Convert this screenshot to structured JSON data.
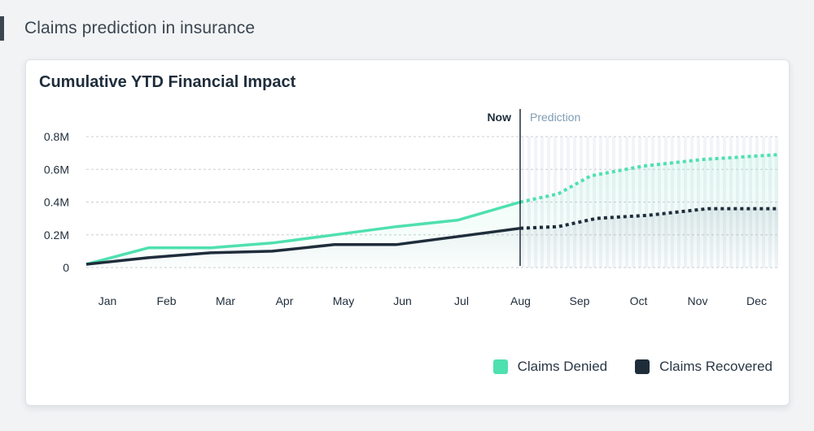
{
  "page": {
    "title": "Claims prediction in insurance"
  },
  "card": {
    "title": "Cumulative YTD Financial Impact"
  },
  "chart_data": {
    "type": "line",
    "title": "Cumulative YTD Financial Impact",
    "xlabel": "",
    "ylabel": "",
    "categories": [
      "Jan",
      "Feb",
      "Mar",
      "Apr",
      "May",
      "Jun",
      "Jul",
      "Aug",
      "Sep",
      "Oct",
      "Nov",
      "Dec"
    ],
    "y_ticks": [
      {
        "value": 0,
        "label": "0"
      },
      {
        "value": 0.2,
        "label": "0.2M"
      },
      {
        "value": 0.4,
        "label": "0.4M"
      },
      {
        "value": 0.6,
        "label": "0.6M"
      },
      {
        "value": 0.8,
        "label": "0.8M"
      }
    ],
    "ylim": [
      0,
      0.8
    ],
    "y_unit": "M",
    "grid": true,
    "now_marker": {
      "label": "Now",
      "at": "Aug"
    },
    "prediction_region": {
      "label": "Prediction",
      "from": "Aug",
      "to": "Dec"
    },
    "series": [
      {
        "name": "Claims Denied",
        "color": "#4fe0b0",
        "actual": [
          0.02,
          0.12,
          0.12,
          0.15,
          0.2,
          0.25,
          0.29,
          0.4
        ],
        "predicted_points": [
          {
            "x": 7.0,
            "y": 0.4
          },
          {
            "x": 7.65,
            "y": 0.45
          },
          {
            "x": 8.2,
            "y": 0.56
          },
          {
            "x": 9.1,
            "y": 0.62
          },
          {
            "x": 10.1,
            "y": 0.66
          },
          {
            "x": 11.4,
            "y": 0.69
          }
        ]
      },
      {
        "name": "Claims Recovered",
        "color": "#1f2d3b",
        "actual": [
          0.02,
          0.06,
          0.09,
          0.1,
          0.14,
          0.14,
          0.19,
          0.24
        ],
        "predicted_points": [
          {
            "x": 7.0,
            "y": 0.24
          },
          {
            "x": 7.65,
            "y": 0.25
          },
          {
            "x": 8.3,
            "y": 0.3
          },
          {
            "x": 9.2,
            "y": 0.32
          },
          {
            "x": 10.2,
            "y": 0.36
          },
          {
            "x": 11.4,
            "y": 0.36
          }
        ]
      }
    ],
    "legend": {
      "position": "bottom-right",
      "items": [
        {
          "label": "Claims Denied",
          "color": "#4fe0b0"
        },
        {
          "label": "Claims Recovered",
          "color": "#1f2d3b"
        }
      ]
    }
  }
}
